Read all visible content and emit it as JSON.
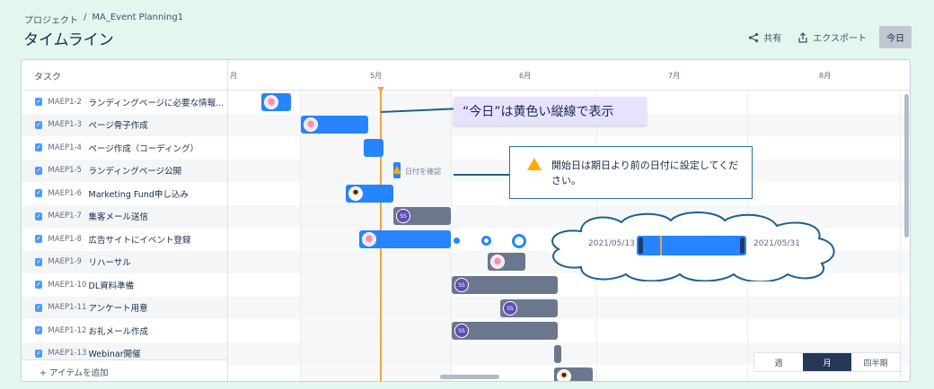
{
  "breadcrumb": {
    "project": "プロジェクト",
    "separator": "/",
    "current": "MA_Event Planning1"
  },
  "title": "タイムライン",
  "actions": {
    "share": "共有",
    "export": "エクスポート",
    "today": "今日"
  },
  "list": {
    "header": "タスク",
    "rows": [
      {
        "key": "MAEP1-2",
        "summary": "ランディングページに必要な情報..."
      },
      {
        "key": "MAEP1-3",
        "summary": "ページ骨子作成"
      },
      {
        "key": "MAEP1-4",
        "summary": "ページ作成（コーディング）"
      },
      {
        "key": "MAEP1-5",
        "summary": "ランディングページ公開"
      },
      {
        "key": "MAEP1-6",
        "summary": "Marketing Fund申し込み"
      },
      {
        "key": "MAEP1-7",
        "summary": "集客メール送信"
      },
      {
        "key": "MAEP1-8",
        "summary": "広告サイトにイベント登録"
      },
      {
        "key": "MAEP1-9",
        "summary": "リハーサル"
      },
      {
        "key": "MAEP1-10",
        "summary": "DL資料準備"
      },
      {
        "key": "MAEP1-11",
        "summary": "アンケート用意"
      },
      {
        "key": "MAEP1-12",
        "summary": "お礼メール作成"
      },
      {
        "key": "MAEP1-13",
        "summary": "Webinar開催"
      }
    ],
    "add_item": "+ アイテムを追加"
  },
  "months": [
    "月",
    "5月",
    "6月",
    "7月",
    "8月"
  ],
  "chart": {
    "confirm_date": "日付を確認",
    "avatar_initials": "SS"
  },
  "view_switch": {
    "week": "週",
    "month": "月",
    "quarter": "四半期",
    "active": "month"
  },
  "callouts": {
    "today_note": "“今日”は黄色い縦線で表示",
    "warning": "開始日は期日より前の日付に設定してください。",
    "range_start": "2021/05/13",
    "range_end": "2021/05/31"
  },
  "colors": {
    "bar_blue": "#2684ff",
    "bar_gray": "#6b778c",
    "today_line": "#f4a23b",
    "accent": "#253858"
  },
  "icons": {
    "share": "share-icon",
    "export": "export-icon",
    "warning": "warning-icon",
    "check": "checkbox-icon"
  }
}
